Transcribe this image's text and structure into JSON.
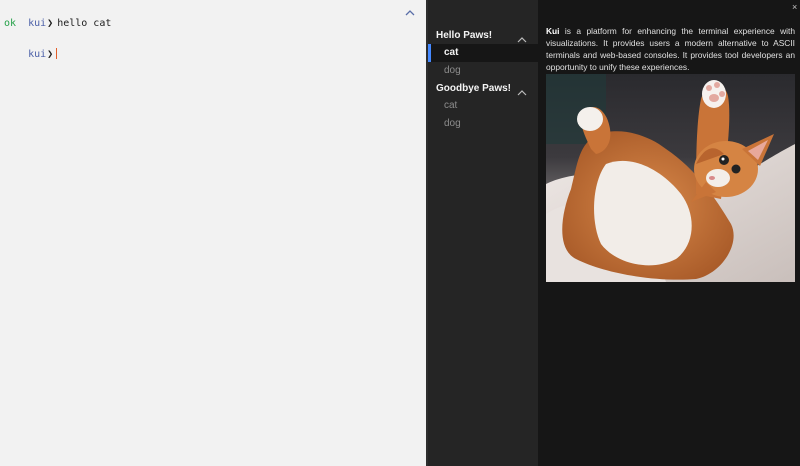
{
  "terminal": {
    "history": [
      {
        "prompt": "kui",
        "command": "hello cat",
        "output": "ok"
      }
    ],
    "current_prompt": "kui"
  },
  "sidebar": {
    "groups": [
      {
        "label": "Hello Paws!",
        "items": [
          {
            "label": "cat",
            "active": true
          },
          {
            "label": "dog",
            "active": false
          }
        ]
      },
      {
        "label": "Goodbye Paws!",
        "items": [
          {
            "label": "cat",
            "active": false
          },
          {
            "label": "dog",
            "active": false
          }
        ]
      }
    ]
  },
  "content": {
    "brand": "Kui",
    "description": " is a platform for enhancing the terminal experience with visualizations. It provides users a modern alternative to ASCII terminals and web-based consoles. It provides tool developers an opportunity to unify these experiences.",
    "close_icon": "×",
    "image_subject": "orange and white cat lying on its back with paw raised"
  },
  "icons": {
    "collapse": "chevron-up-icon",
    "close": "close-icon"
  },
  "colors": {
    "accent": "#4589ff",
    "prompt": "#4b5fa8",
    "ok": "#24a148",
    "cursor": "#e35f2a"
  }
}
